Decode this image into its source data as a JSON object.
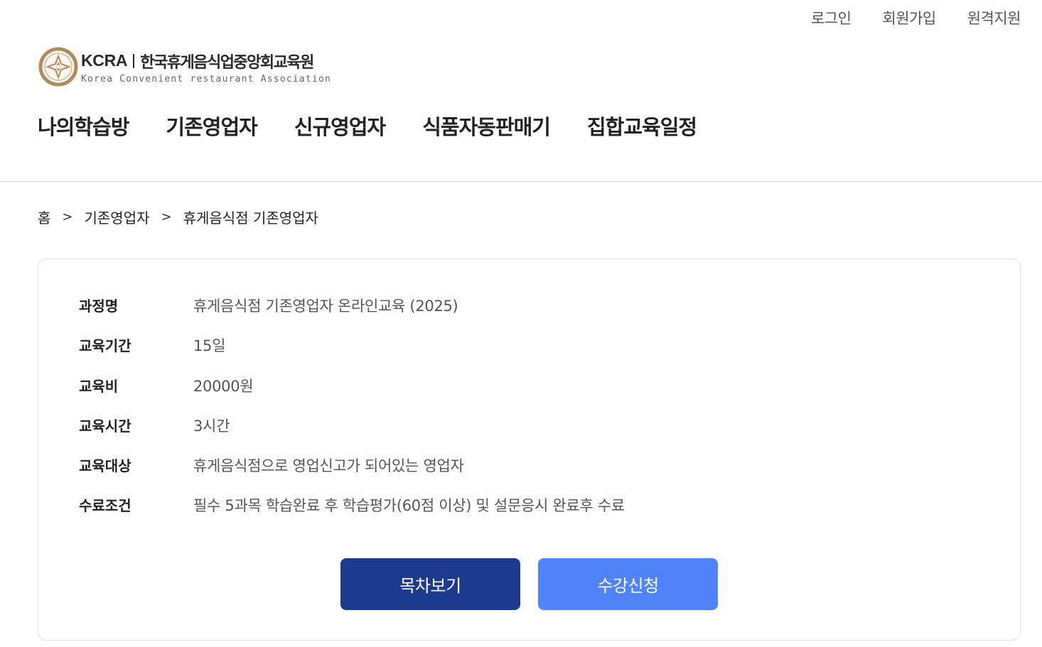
{
  "util_nav": [
    {
      "label": "로그인"
    },
    {
      "label": "회원가입"
    },
    {
      "label": "원격지원"
    }
  ],
  "logo": {
    "abbr": "KCRA",
    "name": "한국휴게음식업중앙회교육원",
    "subtitle": "Korea Convenient restaurant Association",
    "emblem_icon": "kcra-emblem-icon",
    "colors": {
      "ring": "#b28a5e",
      "accent": "#d6b88f"
    }
  },
  "main_nav": [
    {
      "label": "나의학습방"
    },
    {
      "label": "기존영업자"
    },
    {
      "label": "신규영업자"
    },
    {
      "label": "식품자동판매기"
    },
    {
      "label": "집합교육일정"
    }
  ],
  "breadcrumb": {
    "separator": ">",
    "items": [
      {
        "label": "홈"
      },
      {
        "label": "기존영업자"
      },
      {
        "label": "휴게음식점 기존영업자"
      }
    ]
  },
  "course": {
    "rows": [
      {
        "label": "과정명",
        "value": "휴게음식점 기존영업자 온라인교육 (2025)"
      },
      {
        "label": "교육기간",
        "value": "15일"
      },
      {
        "label": "교육비",
        "value": "20000원"
      },
      {
        "label": "교육시간",
        "value": "3시간"
      },
      {
        "label": "교육대상",
        "value": "휴게음식점으로 영업신고가 되어있는 영업자"
      },
      {
        "label": "수료조건",
        "value": "필수 5과목 학습완료 후 학습평가(60점 이상) 및 설문응시 완료후 수료"
      }
    ]
  },
  "buttons": {
    "toc_label": "목차보기",
    "enroll_label": "수강신청",
    "toc_color": "#1c3b8e",
    "enroll_color": "#4f83f7"
  }
}
